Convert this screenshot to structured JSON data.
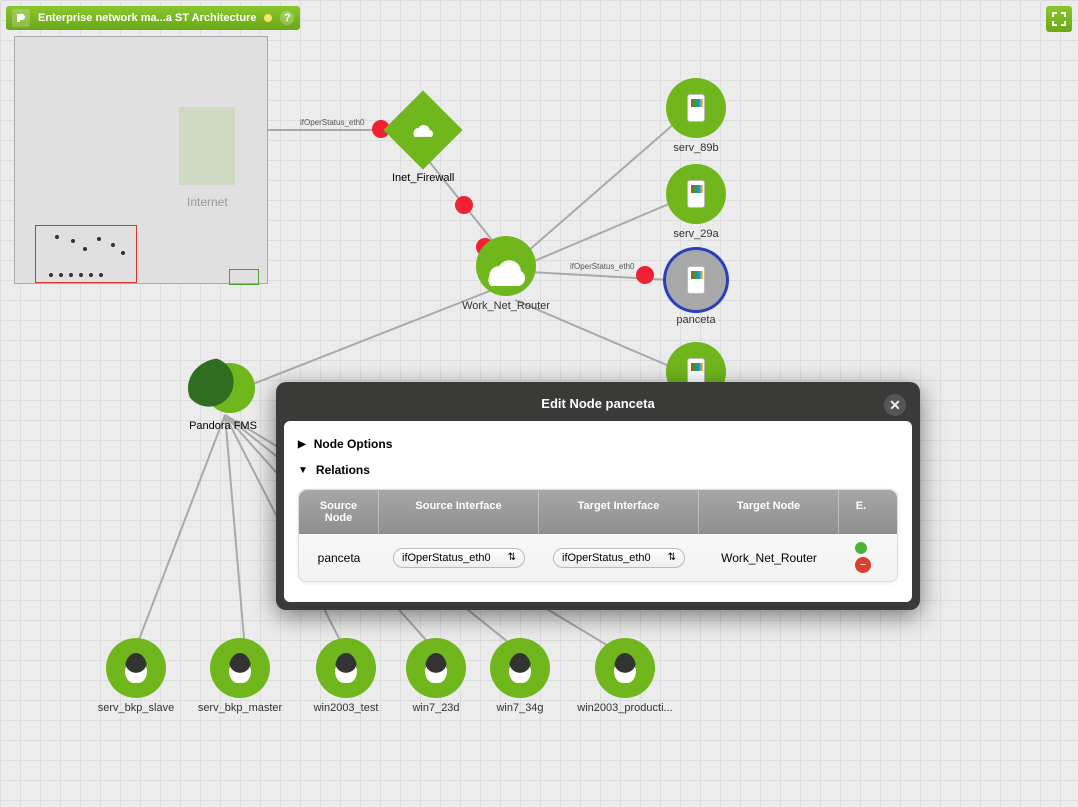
{
  "titlebar": {
    "title": "Enterprise network ma...a ST Architecture",
    "help": "?"
  },
  "minimap": {
    "label": "Internet"
  },
  "firewall": {
    "label": "Inet_Firewall"
  },
  "router": {
    "label": "Work_Net_Router"
  },
  "logo_node": {
    "label": "Pandora FMS"
  },
  "nodes": {
    "serv_89b": "serv_89b",
    "serv_29a": "serv_29a",
    "panceta": "panceta",
    "serv_bkp_slave": "serv_bkp_slave",
    "serv_bkp_master": "serv_bkp_master",
    "win2003_test": "win2003_test",
    "win7_23d": "win7_23d",
    "win7_34g": "win7_34g",
    "win2003_producti": "win2003_producti..."
  },
  "edge_labels": {
    "fw_left": "ifOperStatus_eth0",
    "rt_right": "ifOperStatus_eth0"
  },
  "dialog": {
    "title": "Edit Node panceta",
    "section_options": "Node Options",
    "section_relations": "Relations",
    "headers": {
      "source_node": "Source Node",
      "source_if": "Source Interface",
      "target_if": "Target Interface",
      "target_node": "Target Node",
      "e": "E."
    },
    "row": {
      "source_node": "panceta",
      "source_if": "ifOperStatus_eth0",
      "target_if": "ifOperStatus_eth0",
      "target_node": "Work_Net_Router"
    }
  }
}
